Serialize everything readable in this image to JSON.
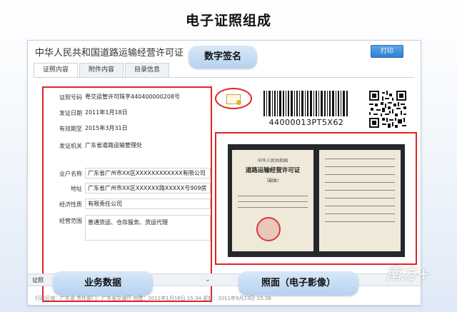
{
  "slide": {
    "title": "电子证照组成"
  },
  "window": {
    "title": "中华人民共和国道路运输经营许可证",
    "print_label": "打印",
    "tabs": [
      {
        "label": "证照内容"
      },
      {
        "label": "附件内容"
      },
      {
        "label": "目录信息"
      }
    ]
  },
  "fields": [
    {
      "label": "证照号码",
      "value": "粤交运管许可珠字440400000208号"
    },
    {
      "label": "发证日期",
      "value": "2011年1月18日"
    },
    {
      "label": "有效期至",
      "value": "2015年3月31日"
    },
    {
      "label": "发证机关",
      "value": "广东省道路运输管理处"
    },
    {
      "label": "业户名称",
      "value": "广东省广州市XX区XXXXXXXXXXXX有限公司"
    },
    {
      "label": "地址",
      "value": "广东省广州市XX区XXXXXX路XXXXX号909房"
    },
    {
      "label": "经济性质",
      "value": "有限责任公司"
    },
    {
      "label": "经营范围",
      "value": "普通货运、仓存服务、货运代理"
    }
  ],
  "barcode": {
    "number": "44000013PT5X62"
  },
  "certificate": {
    "head": "中华人民共和国",
    "main": "道路运输经营许可证",
    "sub": "（副本）"
  },
  "bottom_bar": {
    "label": "证照"
  },
  "status": {
    "text": "行政区域：广东省  责任部门：广东省交通厅  创建：2011年1月18日 15:34  更新：2011年9月23日 15:38"
  },
  "callouts": {
    "digital_signature": "数字签名",
    "business_data": "业务数据",
    "photo": "照面（电子影像）"
  },
  "watermark": {
    "text": "南方+"
  },
  "colors": {
    "highlight": "#e02424",
    "callout": "#c5dcf4",
    "button": "#3a8ad8"
  }
}
